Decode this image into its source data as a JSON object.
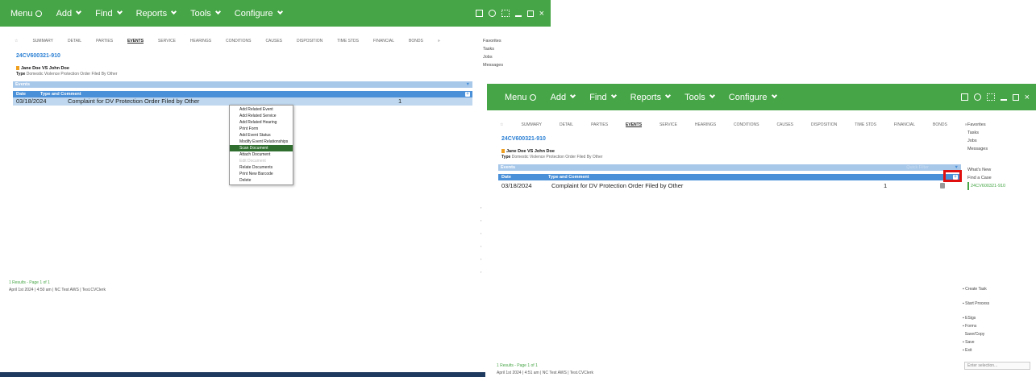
{
  "menu": {
    "items": [
      "Menu",
      "Add",
      "Find",
      "Reports",
      "Tools",
      "Configure"
    ]
  },
  "tabs": [
    "SUMMARY",
    "DETAIL",
    "PARTIES",
    "EVENTS",
    "SERVICE",
    "HEARINGS",
    "CONDITIONS",
    "CAUSES",
    "DISPOSITION",
    "TIME STDS",
    "FINANCIAL",
    "BONDS",
    "»"
  ],
  "case": {
    "number": "24CV600321-910",
    "parties": "Jane Doe VS John Doe",
    "type_label": "Type",
    "type_value": "Domestic Violence Protection Order Filed By Other"
  },
  "events": {
    "header": "Events",
    "col_date": "Date",
    "col_type": "Type and Comment",
    "row": {
      "date": "03/18/2024",
      "desc": "Complaint for DV Protection Order Filed by Other",
      "count": "1"
    },
    "filter_hint": "Quick Filter"
  },
  "ctx_menu": [
    "Add Related Event",
    "Add Related Service",
    "Add Related Hearing",
    "Print Form",
    "Add Event Status",
    "Modify Event Relationships",
    "Scan Document",
    "Attach Document",
    "Edit Document",
    "Relate Documents",
    "Print New Barcode",
    "Delete"
  ],
  "sidebar": {
    "top": [
      "Favorites",
      "Tasks",
      "Jobs",
      "Messages"
    ],
    "links": [
      "What's New",
      "Find a Case",
      "24CV600321-910"
    ],
    "actions": [
      "Create Task",
      "Start Process",
      "ESigs",
      "Forms",
      "Save/Copy",
      "Save",
      "Exit"
    ],
    "enter_placeholder": "Enter selection..."
  },
  "status": {
    "results": "1 Results - Page 1 of 1",
    "left_bar": "April 1st 2024 | 4:50 am | NC Test AWS | Test.CVClerk",
    "right_bar": "April 1st 2024 | 4:51 am | NC Test AWS | Test.CVClerk"
  },
  "colors": {
    "brand": "#46a546",
    "header_blue": "#4a90d8",
    "highlight": "#e01010"
  }
}
